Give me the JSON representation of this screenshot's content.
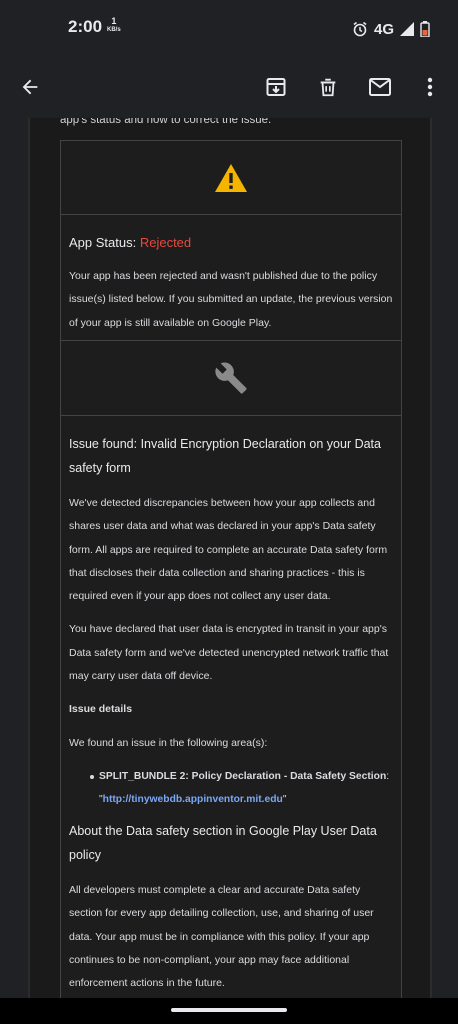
{
  "status_bar": {
    "time": "2:00",
    "speed_value": "1",
    "speed_unit": "KB/s",
    "network": "4G"
  },
  "app_bar": {
    "icons": [
      "back-arrow-icon",
      "archive-icon",
      "delete-icon",
      "mark-unread-icon",
      "more-vert-icon"
    ]
  },
  "email": {
    "cut_line": "app's status and how to correct the issue.",
    "status_label": "App Status: ",
    "status_value": "Rejected",
    "status_color": "#e8483f",
    "status_paragraph": "Your app has been rejected and wasn't published due to the policy issue(s) listed below. If you submitted an update, the previous version of your app is still available on Google Play.",
    "issue_title": "Issue found: Invalid Encryption Declaration on your Data safety form",
    "issue_p1": "We've detected discrepancies between how your app collects and shares user data and what was declared in your app's Data safety form. All apps are required to complete an accurate Data safety form that discloses their data collection and sharing practices - this is required even if your app does not collect any user data.",
    "issue_p2": "You have declared that user data is encrypted in transit in your app's Data safety form and we've detected unencrypted network traffic that may carry user data off device.",
    "details_heading": "Issue details",
    "details_intro": "We found an issue in the following area(s):",
    "bullet_label": "SPLIT_BUNDLE 2: Policy Declaration - Data Safety Section",
    "bullet_sep": ": \"",
    "bullet_link": "http://tinywebdb.appinventor.mit.edu",
    "bullet_end": "\"",
    "about_title": "About the Data safety section in Google Play User Data policy",
    "about_p": "All developers must complete a clear and accurate Data safety section for every app detailing collection, use, and sharing of user data. Your app must be in compliance with this policy. If your app continues to be non-compliant, your app may face additional enforcement actions in the future."
  },
  "colors": {
    "accent_link": "#7aa7f5",
    "warning": "#f4b400"
  }
}
